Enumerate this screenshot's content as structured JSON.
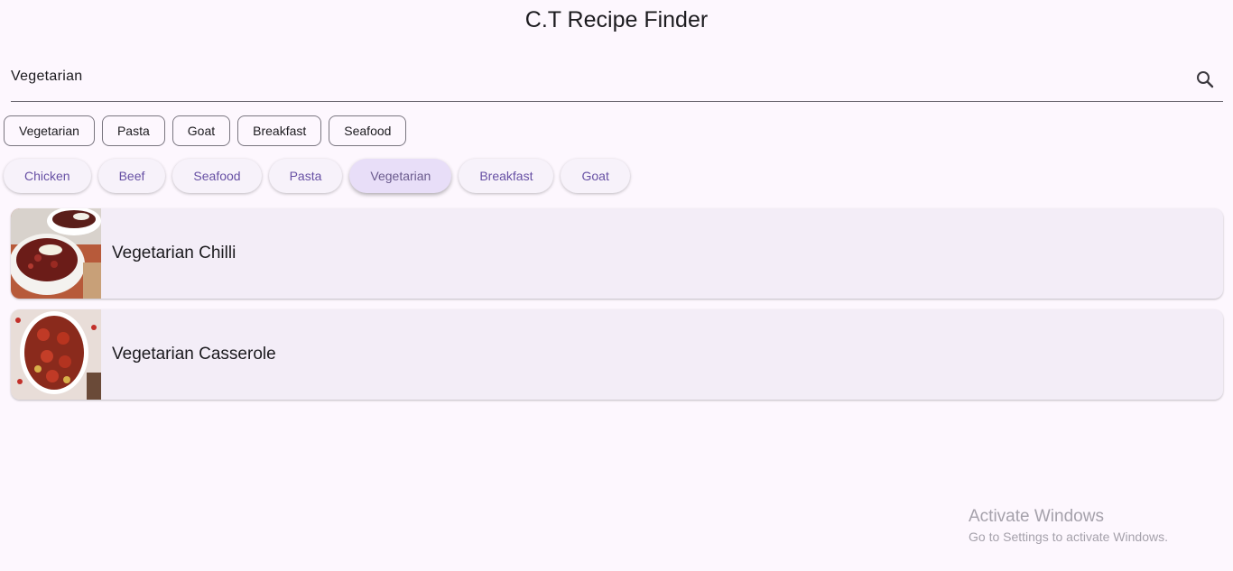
{
  "app": {
    "title": "C.T Recipe Finder"
  },
  "search": {
    "value": "Vegetarian",
    "icon": "search-icon"
  },
  "recent_searches": [
    "Vegetarian",
    "Pasta",
    "Goat",
    "Breakfast",
    "Seafood"
  ],
  "categories": {
    "items": [
      "Chicken",
      "Beef",
      "Seafood",
      "Pasta",
      "Vegetarian",
      "Breakfast",
      "Goat"
    ],
    "selected": "Vegetarian"
  },
  "results": [
    {
      "name": "Vegetarian Chilli"
    },
    {
      "name": "Vegetarian Casserole"
    }
  ],
  "watermark": {
    "title": "Activate Windows",
    "subtitle": "Go to Settings to activate Windows."
  },
  "colors": {
    "background": "#fdf7fe",
    "chip_text": "#6750a4",
    "chip_selected": "#e8def8",
    "card_bg": "#f3edf7"
  }
}
